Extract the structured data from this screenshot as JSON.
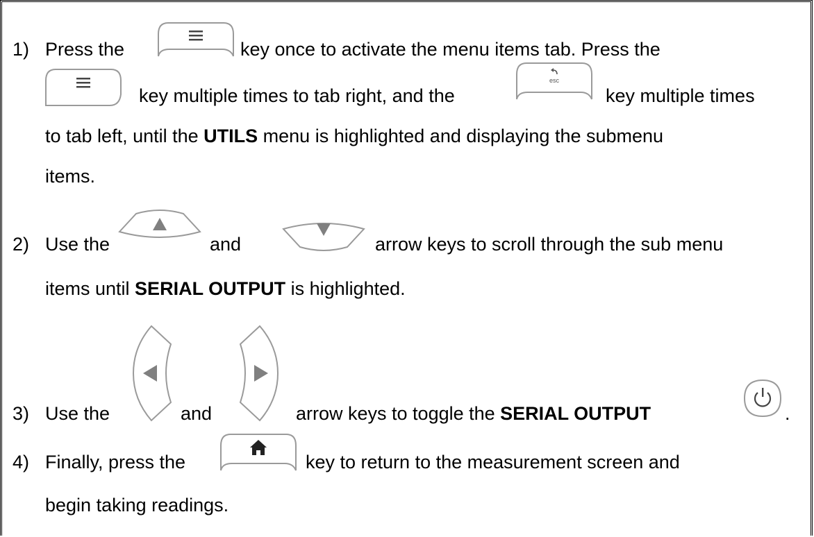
{
  "steps": [
    {
      "num": "1)",
      "p1": "Press the",
      "p2": "key once to activate the menu items tab.  Press the",
      "p3": "key multiple times to tab right, and the",
      "p4": "key multiple times",
      "p5_pre": "to tab left, until the ",
      "p5_bold": "UTILS",
      "p5_post": " menu is highlighted and displaying the submenu",
      "p6": "items."
    },
    {
      "num": "2)",
      "p1": "Use the",
      "p2": "and",
      "p3": "arrow keys to scroll through the sub menu",
      "p4_pre": "items until ",
      "p4_bold": "SERIAL OUTPUT",
      "p4_post": " is highlighted."
    },
    {
      "num": "3)",
      "p1": "Use the",
      "p2": "and",
      "p3_pre": "arrow keys to toggle the ",
      "p3_bold": "SERIAL OUTPUT",
      "p3_post": "."
    },
    {
      "num": "4)",
      "p1": "Finally, press the",
      "p2": "key to return to the measurement screen and",
      "p3": "begin taking readings."
    }
  ],
  "icons": {
    "menu": "menu-key-icon",
    "esc": "esc-key-icon",
    "esc_label": "esc",
    "up": "up-arrow-key-icon",
    "down": "down-arrow-key-icon",
    "left": "left-arrow-key-icon",
    "right": "right-arrow-key-icon",
    "power": "power-key-icon",
    "home": "home-key-icon"
  },
  "colors": {
    "key_outline": "#9a9a9a",
    "arrow_fill": "#808080",
    "text": "#000000"
  }
}
